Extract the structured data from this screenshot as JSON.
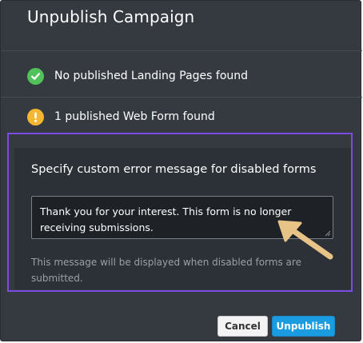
{
  "dialog": {
    "title": "Unpublish Campaign"
  },
  "status": {
    "landing_pages": {
      "text": "No published Landing Pages found",
      "icon": "check-circle-icon",
      "color": "#51c15a"
    },
    "web_forms": {
      "text": "1 published Web Form found",
      "icon": "warning-circle-icon",
      "color": "#f5b631"
    }
  },
  "error_message": {
    "label": "Specify custom error message for disabled forms",
    "value": "Thank you for your interest. This form is no longer receiving submissions.",
    "help": "This message will be displayed when disabled forms are submitted."
  },
  "footer": {
    "cancel_label": "Cancel",
    "unpublish_label": "Unpublish"
  },
  "colors": {
    "dialog_bg": "#353a41",
    "highlight": "#7b4ce0",
    "arrow": "#e8c388",
    "primary": "#1b9be0"
  }
}
